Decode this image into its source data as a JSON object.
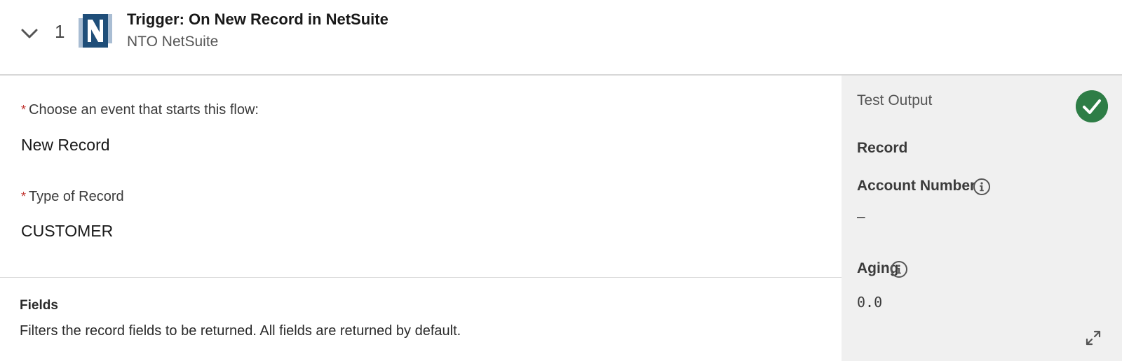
{
  "header": {
    "step_number": "1",
    "title": "Trigger: On New Record in NetSuite",
    "subtitle": "NTO NetSuite",
    "logo_icon": "netsuite-logo"
  },
  "main": {
    "event_field": {
      "required_marker": "*",
      "label": "Choose an event that starts this flow:",
      "value": "New Record"
    },
    "record_type_field": {
      "required_marker": "*",
      "label": "Type of Record",
      "value": "CUSTOMER"
    },
    "fields_section": {
      "title": "Fields",
      "description": "Filters the record fields to be returned. All fields are returned by default."
    }
  },
  "test_output": {
    "title": "Test Output",
    "status_icon": "success-check-icon",
    "status_color": "#2e7d46",
    "record_heading": "Record",
    "account_number_label": "Account Number",
    "account_number_value": "–",
    "aging_label": "Aging",
    "aging_value": "0.0"
  },
  "colors": {
    "required": "#c23934",
    "panel_bg": "#f0f0f0",
    "logo_dark": "#1f4e79",
    "logo_light": "#a9bdd3"
  }
}
